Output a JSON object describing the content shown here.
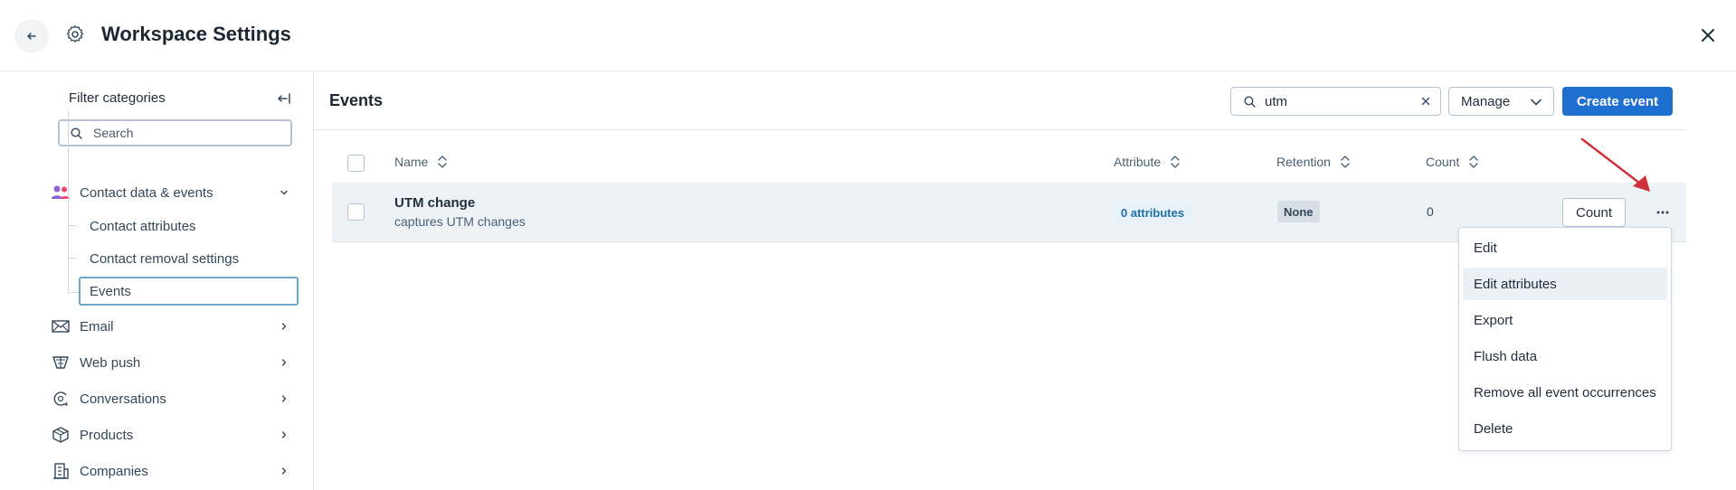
{
  "header": {
    "title": "Workspace Settings"
  },
  "sidebar": {
    "filter_title": "Filter categories",
    "search_placeholder": "Search",
    "categories": [
      {
        "label": "Contact data & events",
        "icon": "contacts-icon",
        "expanded": true
      },
      {
        "label": "Email",
        "icon": "email-icon"
      },
      {
        "label": "Web push",
        "icon": "web-push-icon"
      },
      {
        "label": "Conversations",
        "icon": "conversations-icon"
      },
      {
        "label": "Products",
        "icon": "products-icon"
      },
      {
        "label": "Companies",
        "icon": "companies-icon"
      }
    ],
    "subitems": [
      {
        "label": "Contact attributes"
      },
      {
        "label": "Contact removal settings"
      },
      {
        "label": "Events",
        "active": true
      }
    ]
  },
  "main": {
    "title": "Events",
    "search_value": "utm",
    "manage_label": "Manage",
    "create_label": "Create event",
    "columns": [
      "Name",
      "Attribute",
      "Retention",
      "Count"
    ],
    "rows": [
      {
        "name": "UTM change",
        "description": "captures UTM changes",
        "attribute": "0 attributes",
        "retention": "None",
        "count": "0",
        "count_button": "Count"
      }
    ],
    "menu": [
      "Edit",
      "Edit attributes",
      "Export",
      "Flush data",
      "Remove all event occurrences",
      "Delete"
    ],
    "menu_hover_index": 1
  },
  "colors": {
    "primary": "#1f6fd0",
    "row_bg": "#edf2f7",
    "annotation_arrow": "#d0303a"
  }
}
